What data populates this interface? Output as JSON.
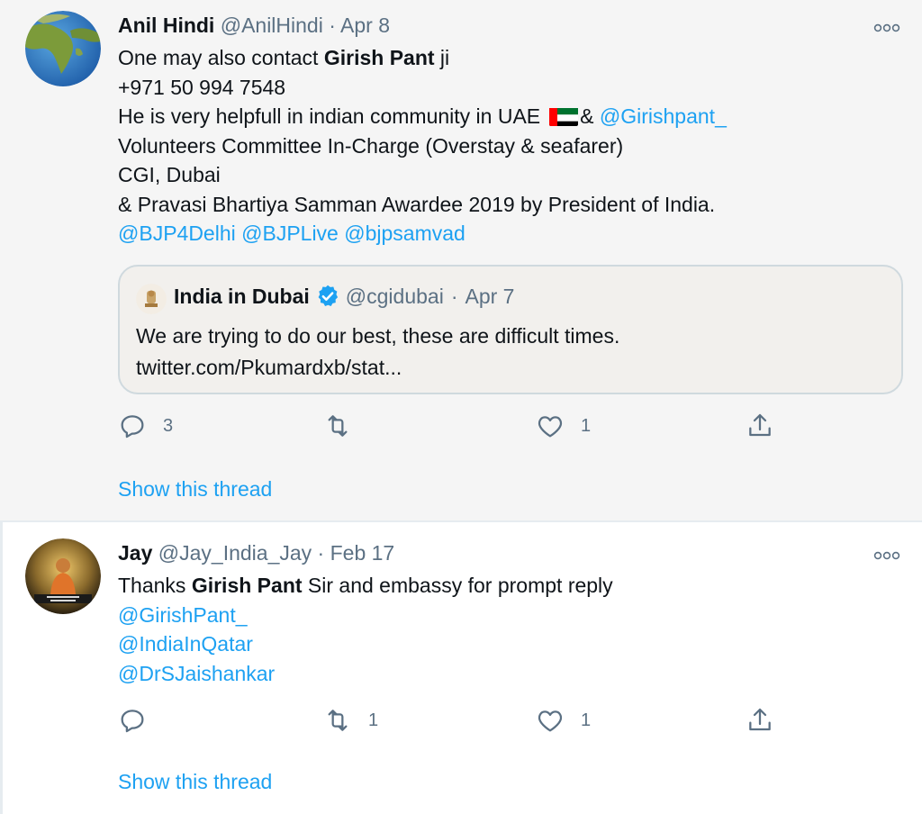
{
  "tweets": [
    {
      "author_name": "Anil Hindi",
      "author_handle": "@AnilHindi",
      "separator": "·",
      "date": "Apr 8",
      "body": {
        "l1_pre": "One may also contact ",
        "l1_bold": "Girish Pant",
        "l1_post": " ji",
        "l2": "+971 50 994 7548",
        "l3_pre": "He is very helpfull in indian community in UAE",
        "l3_amp": "& ",
        "l3_mention": "@Girishpant_",
        "l4": "Volunteers Committee In-Charge (Overstay & seafarer)",
        "l5": "CGI, Dubai",
        "l6": "& Pravasi Bhartiya Samman Awardee 2019  by President of India.",
        "m1": "@BJP4Delhi",
        "m2": "@BJPLive",
        "m3": "@bjpsamvad"
      },
      "quote": {
        "name": "India in Dubai",
        "handle": "@cgidubai",
        "separator": "·",
        "date": "Apr 7",
        "text": "We are trying to do our best, these are difficult times.",
        "link": "twitter.com/Pkumardxb/stat..."
      },
      "actions": {
        "replies": "3",
        "retweets": "",
        "likes": "1"
      },
      "show_thread": "Show this thread"
    },
    {
      "author_name": "Jay",
      "author_handle": "@Jay_India_Jay",
      "separator": "·",
      "date": "Feb 17",
      "body": {
        "l1_pre": "Thanks ",
        "l1_bold": "Girish Pant",
        "l1_post": " Sir and embassy for prompt reply",
        "m1": "@GirishPant_",
        "m2": "@IndiaInQatar",
        "m3": "@DrSJaishankar"
      },
      "actions": {
        "replies": "",
        "retweets": "1",
        "likes": "1"
      },
      "show_thread": "Show this thread"
    }
  ],
  "colors": {
    "link": "#1da1f2",
    "secondary_text": "#5b7083",
    "highlight_bg": "#f5f5f5",
    "verified": "#1da1f2"
  },
  "icons": {
    "reply": "reply-icon",
    "retweet": "retweet-icon",
    "like": "heart-icon",
    "share": "share-icon",
    "more": "more-dots-icon",
    "verified": "verified-badge-icon",
    "flag": "uae-flag-icon"
  }
}
